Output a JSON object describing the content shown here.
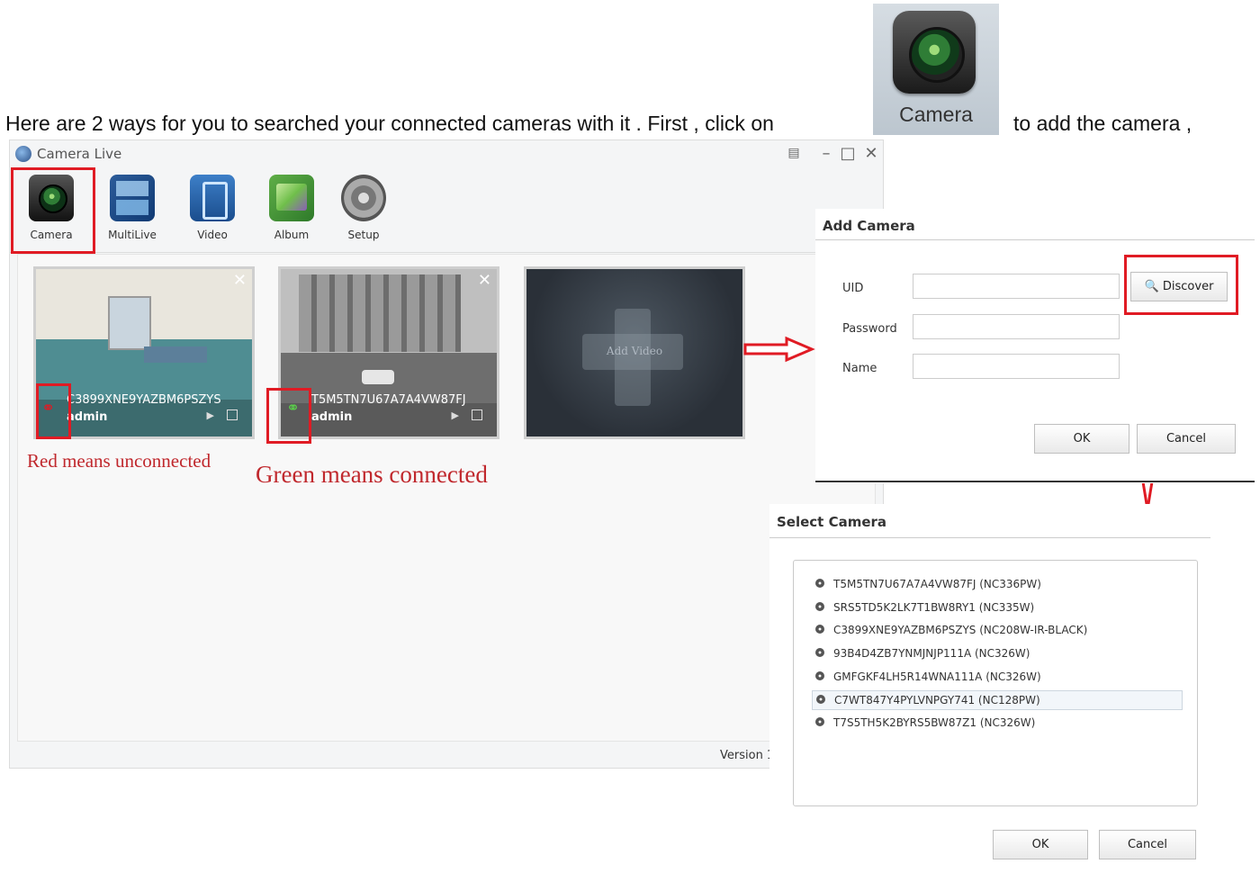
{
  "intro": {
    "text": "Here are 2 ways for you to searched your connected cameras with it . First , click on",
    "tail": "to add the camera ,",
    "camera_icon_label": "Camera"
  },
  "window": {
    "title": "Camera Live",
    "toolbar": [
      {
        "label": "Camera",
        "icon": "camera-icon"
      },
      {
        "label": "MultiLive",
        "icon": "multilive-icon"
      },
      {
        "label": "Video",
        "icon": "video-icon"
      },
      {
        "label": "Album",
        "icon": "album-icon"
      },
      {
        "label": "Setup",
        "icon": "setup-gear-icon"
      }
    ],
    "cameras": [
      {
        "uid": "C3899XNE9YAZBM6PSZYS",
        "user": "admin",
        "status": "unconnected",
        "link_color": "#e01b24"
      },
      {
        "uid": "T5M5TN7U67A7A4VW87FJ",
        "user": "admin",
        "status": "connected",
        "link_color": "#5ad14a"
      }
    ],
    "add_video_label": "Add Video",
    "captions": {
      "red": "Red means unconnected",
      "green": "Green means connected"
    },
    "version": "Version 1"
  },
  "add_camera": {
    "title": "Add Camera",
    "uid_label": "UID",
    "password_label": "Password",
    "name_label": "Name",
    "uid_value": "",
    "discover_label": "Discover",
    "ok_label": "OK",
    "cancel_label": "Cancel"
  },
  "select_camera": {
    "title": "Select Camera",
    "items": [
      "T5M5TN7U67A7A4VW87FJ  (NC336PW)",
      "SRS5TD5K2LK7T1BW8RY1  (NC335W)",
      "C3899XNE9YAZBM6PSZYS  (NC208W-IR-BLACK)",
      "93B4D4ZB7YNMJNJP111A  (NC326W)",
      "GMFGKF4LH5R14WNA111A  (NC326W)",
      "C7WT847Y4PYLVNPGY741  (NC128PW)",
      "T7S5TH5K2BYRS5BW87Z1  (NC326W)"
    ],
    "highlighted_index": 5,
    "ok_label": "OK",
    "cancel_label": "Cancel"
  },
  "colors": {
    "highlight_box": "#e01b24",
    "caption_text": "#c0282d",
    "arrow": "#e01b24"
  }
}
